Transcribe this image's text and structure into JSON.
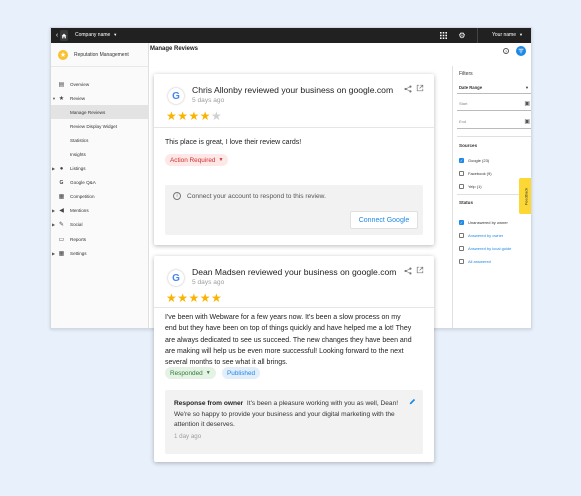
{
  "topbar": {
    "company_name": "Company name",
    "user_name": "Your name"
  },
  "sidebar": {
    "title": "Reputation Management",
    "items": [
      {
        "label": "Overview",
        "icon": "list-icon"
      },
      {
        "label": "Review",
        "icon": "star-icon"
      },
      {
        "label": "Manage Reviews",
        "icon": ""
      },
      {
        "label": "Review Display Widget",
        "icon": ""
      },
      {
        "label": "Statistics",
        "icon": ""
      },
      {
        "label": "Insights",
        "icon": ""
      },
      {
        "label": "Listings",
        "icon": "location-pin-icon"
      },
      {
        "label": "Google Q&A",
        "icon": "google-icon"
      },
      {
        "label": "Competition",
        "icon": "grid-icon"
      },
      {
        "label": "Mentions",
        "icon": "megaphone-icon"
      },
      {
        "label": "Social",
        "icon": "social-icon"
      },
      {
        "label": "Reports",
        "icon": "reports-icon"
      },
      {
        "label": "Settings",
        "icon": "settings-icon"
      }
    ]
  },
  "main": {
    "title": "Manage Reviews"
  },
  "filters": {
    "title": "Filters",
    "date_range_label": "Date Range",
    "start_placeholder": "Start",
    "end_placeholder": "End",
    "sources_label": "Sources",
    "sources": [
      {
        "label": "Google (23)",
        "checked": true
      },
      {
        "label": "Facebook (9)",
        "checked": false
      },
      {
        "label": "Yelp (1)",
        "checked": false
      }
    ],
    "status_label": "Status",
    "statuses": [
      {
        "label": "Unanswered by owner",
        "checked": true
      },
      {
        "label": "Answered by owner",
        "checked": false
      },
      {
        "label": "Answered by local guide",
        "checked": false
      },
      {
        "label": "All answered",
        "checked": false
      }
    ],
    "feedback_label": "Feedback"
  },
  "reviews": [
    {
      "title": "Chris Allonby reviewed your business on google.com",
      "time": "5 days ago",
      "rating": 4,
      "body": "This place is great, I love their review cards!",
      "status_chip": "Action Required",
      "notice": "Connect your account to respond to this review.",
      "connect_label": "Connect Google"
    },
    {
      "title": "Dean Madsen reviewed your business on google.com",
      "time": "5 days ago",
      "rating": 5,
      "body_lines": [
        "I've been with Webware for a few years now. It's been a slow process on my",
        "end but they have been on top of things quickly and have helped me a lot! They",
        "are always dedicated to see us succeed. The new changes they have been and",
        "are making will help us be even more successful! Looking forward to the next",
        "several months to see what it all brings."
      ],
      "responded_chip": "Responded",
      "published_chip": "Published",
      "response_label": "Response from owner",
      "response_text": "It's been a pleasure working with you as well, Dean! We're so happy to provide your business and your digital marketing with the attention it deserves.",
      "response_time": "1 day ago"
    }
  ],
  "colors": {
    "accent": "#1e88e5",
    "star": "#f9b400",
    "topbar": "#212121",
    "feedback": "#fdd835"
  }
}
